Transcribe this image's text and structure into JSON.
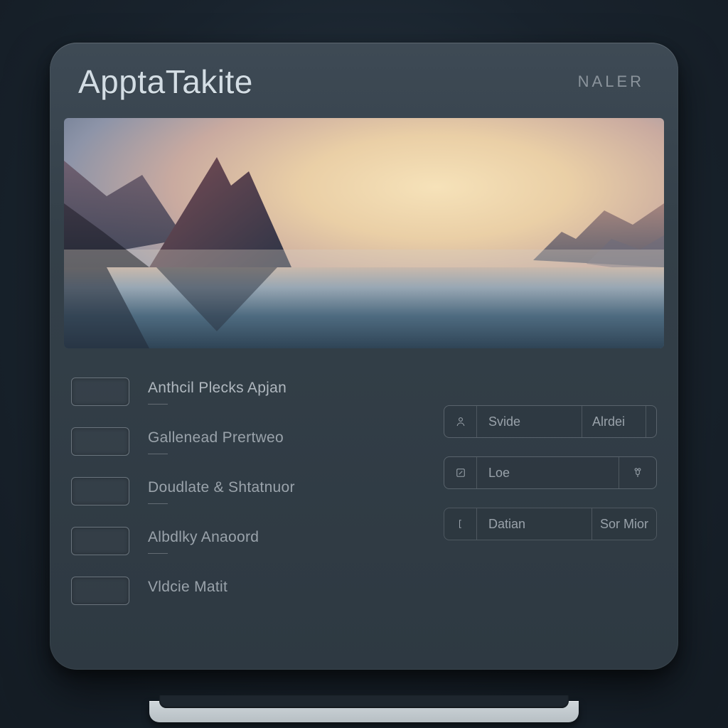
{
  "header": {
    "title": "ApptaTakite",
    "right": "NALER"
  },
  "hero": {
    "alt": "Sunset over misty mountains and calm water"
  },
  "list": {
    "items": [
      {
        "label": "Anthcil Plecks Apjan"
      },
      {
        "label": "Gallenead  Prertweo"
      },
      {
        "label": "Doudlate & Shtatnuor"
      },
      {
        "label": "Albdlky Anaoord"
      },
      {
        "label": "Vldcie Matit"
      }
    ]
  },
  "controls": {
    "rows": [
      {
        "icon": "person-icon",
        "primary": "Svide",
        "secondary": "Alrdei",
        "trailing_icon": null
      },
      {
        "icon": "edit-icon",
        "primary": "Loe",
        "secondary": null,
        "trailing_icon": "tool-icon"
      },
      {
        "icon": "bracket-icon",
        "primary": "Datian",
        "secondary": "Sor Mior",
        "trailing_icon": null
      }
    ]
  }
}
